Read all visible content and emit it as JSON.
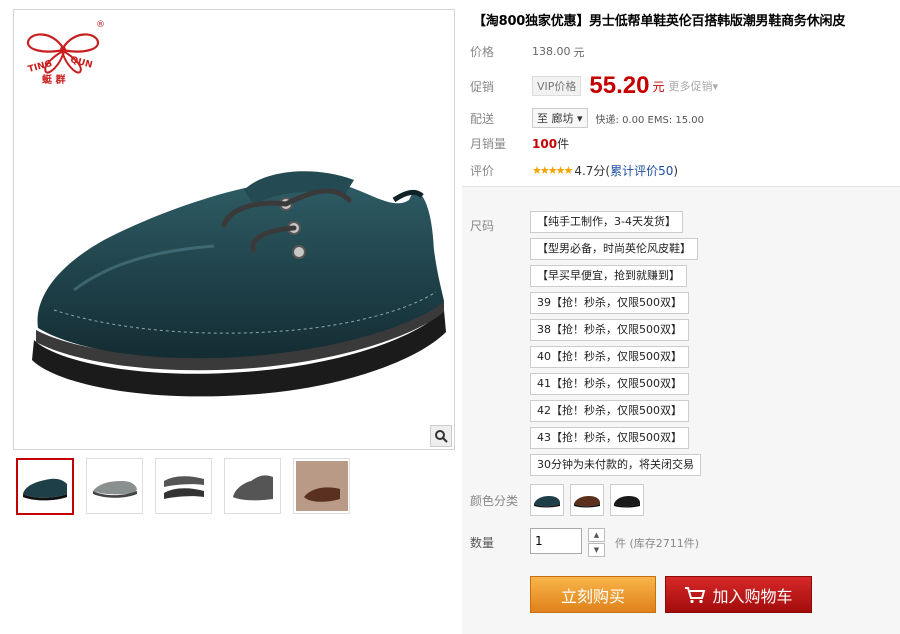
{
  "product": {
    "title": "【淘800独家优惠】男士低帮单鞋英伦百搭韩版潮男鞋商务休闲皮"
  },
  "brand": {
    "logo_text_left": "TING",
    "logo_text_right": "QUN",
    "logo_cn": "蜓 群",
    "reg_mark": "®"
  },
  "gallery": {
    "active_index": 0,
    "thumbnails": [
      "thumb-1",
      "thumb-2",
      "thumb-3",
      "thumb-4",
      "thumb-5"
    ],
    "zoom_icon": "zoom-icon"
  },
  "price": {
    "label": "价格",
    "original": "138.00",
    "original_unit": "元"
  },
  "promo": {
    "label": "促销",
    "tag": "VIP价格",
    "price": "55.20",
    "unit": "元",
    "more": "更多促销▾"
  },
  "delivery": {
    "label": "配送",
    "destination": "至 廊坊 ▾",
    "shipping": "快递: 0.00 EMS: 15.00"
  },
  "sales": {
    "label": "月销量",
    "count": "100",
    "unit": "件"
  },
  "rating": {
    "label": "评价",
    "stars": "★★★★★",
    "score": "4.7分(",
    "link": "累计评价50",
    "close": ")"
  },
  "sizes": {
    "label": "尺码",
    "options": [
      "【纯手工制作，3-4天发货】",
      "【型男必备，时尚英伦风皮鞋】",
      "【早买早便宜，抢到就赚到】",
      "39【抢！秒杀，仅限500双】",
      "38【抢！秒杀，仅限500双】",
      "40【抢！秒杀，仅限500双】",
      "41【抢！秒杀，仅限500双】",
      "42【抢！秒杀，仅限500双】",
      "43【抢！秒杀，仅限500双】",
      "30分钟为未付款的，将关闭交易"
    ]
  },
  "colors": {
    "label": "颜色分类",
    "options": [
      "swatch-dark-green",
      "swatch-brown",
      "swatch-black"
    ]
  },
  "quantity": {
    "label": "数量",
    "value": "1",
    "up": "▲",
    "down": "▼",
    "stock": "件  (库存2711件)"
  },
  "actions": {
    "buy": "立刻购买",
    "cart": "加入购物车"
  },
  "colors_theme": {
    "accent": "#c40000",
    "buy": "#e0821b",
    "cart": "#b31212"
  }
}
